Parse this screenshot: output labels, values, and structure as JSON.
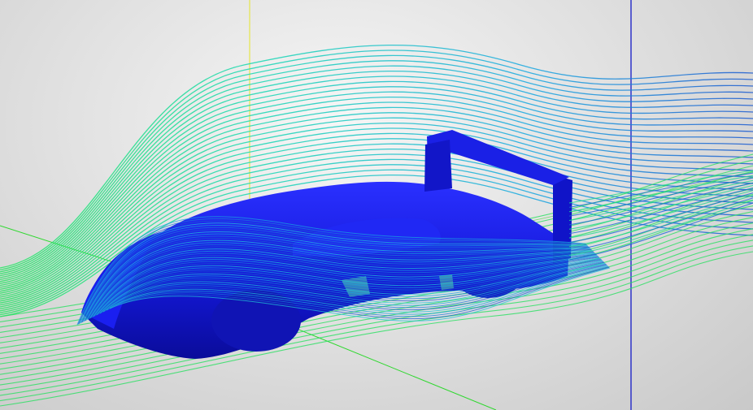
{
  "scene": {
    "subject": "race-car",
    "colors": {
      "background_light": "#f4f4f4",
      "background_dark": "#c8c8c8",
      "car_body": "#1418d8",
      "car_shadow": "#0a0c9a",
      "streamline_fast": "#22e860",
      "streamline_mid": "#18c8d8",
      "streamline_slow": "#1a5ad0",
      "axis_green": "#2ed82e",
      "axis_yellow": "#e6e64a",
      "axis_blue": "#2228c8"
    },
    "icons": [
      "streamline",
      "axis-line",
      "car-model"
    ]
  }
}
